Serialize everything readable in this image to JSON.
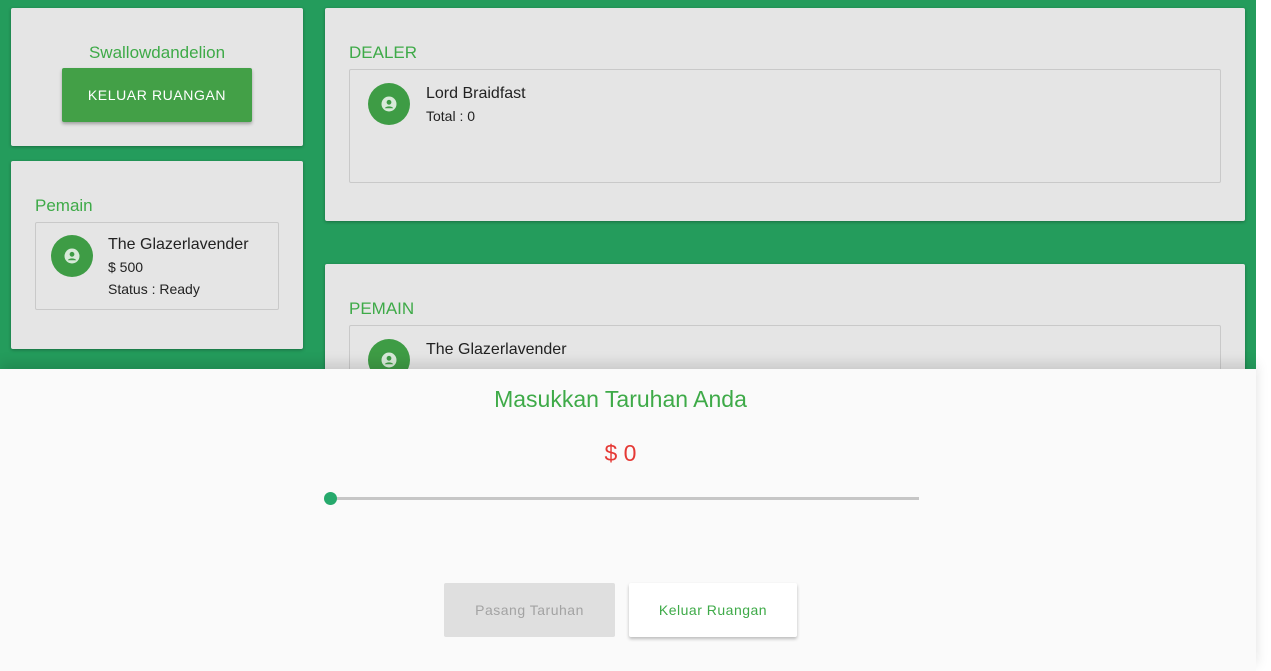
{
  "user_card": {
    "username": "Swallowdandelion",
    "exit_button": "KELUAR RUANGAN"
  },
  "players_card": {
    "title": "Pemain",
    "player": {
      "name": "The Glazerlavender",
      "money": "$ 500",
      "status": "Status : Ready"
    }
  },
  "dealer_card": {
    "title": "DEALER",
    "dealer": {
      "name": "Lord Braidfast",
      "total": "Total : 0"
    }
  },
  "table_players_card": {
    "title": "PEMAIN",
    "player": {
      "name": "The Glazerlavender"
    }
  },
  "bet_sheet": {
    "title": "Masukkan Taruhan Anda",
    "amount": "$ 0",
    "slider_value": 0,
    "place_bet_button": "Pasang Taruhan",
    "exit_button": "Keluar Ruangan"
  },
  "colors": {
    "background": "#249c5c",
    "accent": "#43a047",
    "amount": "#e53935",
    "slider": "#26a96c"
  }
}
